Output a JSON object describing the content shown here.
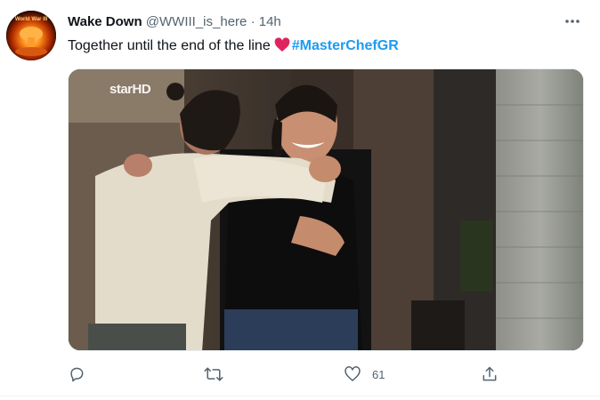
{
  "tweet": {
    "display_name": "Wake Down",
    "handle": "@WWIII_is_here",
    "separator": "·",
    "time": "14h",
    "text": "Together until the end of the line",
    "hashtag": "#MasterChefGR",
    "avatar_text": "World War III",
    "media_watermark": "starHD"
  },
  "actions": {
    "reply_count": "",
    "retweet_count": "",
    "like_count": "61"
  },
  "colors": {
    "accent": "#1d9bf0",
    "heart_emoji": "#e0245e",
    "secondary_text": "#536471"
  },
  "icons": [
    "more-icon",
    "heart-emoji-icon",
    "reply-icon",
    "retweet-icon",
    "like-icon",
    "share-icon"
  ]
}
